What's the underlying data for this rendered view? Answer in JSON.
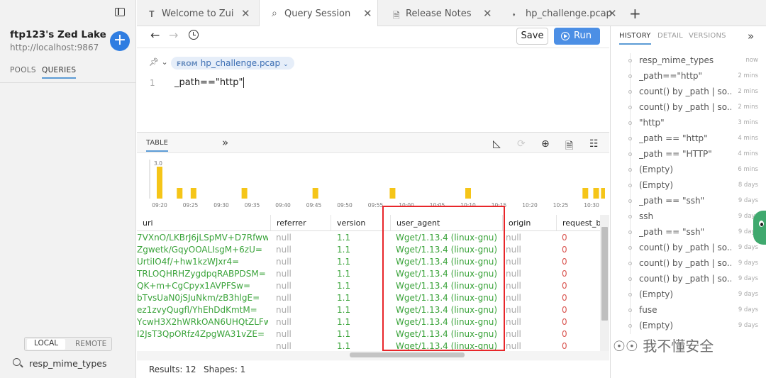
{
  "sidebar": {
    "lake_title": "ftp123's Zed Lake",
    "lake_url": "http://localhost:9867",
    "tabs": [
      "POOLS",
      "QUERIES"
    ],
    "lake_toggle": [
      "LOCAL",
      "REMOTE"
    ],
    "search_value": "resp_mime_types"
  },
  "tabs": [
    {
      "icon": "zed-icon",
      "label": "Welcome to Zui"
    },
    {
      "icon": "search-icon",
      "label": "Query Session"
    },
    {
      "icon": "document-icon",
      "label": "Release Notes"
    },
    {
      "icon": "pool-icon",
      "label": "hp_challenge.pcap"
    }
  ],
  "toolbar": {
    "save_label": "Save",
    "run_label": "Run"
  },
  "editor": {
    "from_keyword": "FROM",
    "pool": "hp_challenge.pcap",
    "line_number": "1",
    "query": "_path==\"http\""
  },
  "results": {
    "view_tab": "TABLE",
    "histogram": {
      "type": "bar",
      "y_max_label": "3.0",
      "x_tick_labels": [
        "09:20",
        "09:25",
        "09:30",
        "09:35",
        "09:40",
        "09:45",
        "09:50",
        "09:55",
        "10:00",
        "10:05",
        "10:10",
        "10:15",
        "10:20",
        "10:25",
        "10:30"
      ],
      "color": "#f5c518"
    },
    "columns": [
      "uri",
      "referrer",
      "version",
      "user_agent",
      "origin",
      "request_bo"
    ],
    "rows": [
      {
        "uri": "7VXnO/LKBrJ6jLSpMV+D7Rfww=",
        "referrer": "null",
        "version": "1.1",
        "user_agent": "Wget/1.13.4 (linux-gnu)",
        "origin": "null",
        "request_body_len": "0"
      },
      {
        "uri": "Zgwetk/GqyOOALIsgM+6zU=",
        "referrer": "null",
        "version": "1.1",
        "user_agent": "Wget/1.13.4 (linux-gnu)",
        "origin": "null",
        "request_body_len": "0"
      },
      {
        "uri": "UrtiIO4f/+hw1kzWJxr4=",
        "referrer": "null",
        "version": "1.1",
        "user_agent": "Wget/1.13.4 (linux-gnu)",
        "origin": "null",
        "request_body_len": "0"
      },
      {
        "uri": "TRLOQHRHZygdpqRABPDSM=",
        "referrer": "null",
        "version": "1.1",
        "user_agent": "Wget/1.13.4 (linux-gnu)",
        "origin": "null",
        "request_body_len": "0"
      },
      {
        "uri": "QK+m+CgCpyx1AVPFSw=",
        "referrer": "null",
        "version": "1.1",
        "user_agent": "Wget/1.13.4 (linux-gnu)",
        "origin": "null",
        "request_body_len": "0"
      },
      {
        "uri": "bTvsUaN0jSJuNkm/zB3hlgE=",
        "referrer": "null",
        "version": "1.1",
        "user_agent": "Wget/1.13.4 (linux-gnu)",
        "origin": "null",
        "request_body_len": "0"
      },
      {
        "uri": "ez1zvyQugfl/YhEhDdKmtM=",
        "referrer": "null",
        "version": "1.1",
        "user_agent": "Wget/1.13.4 (linux-gnu)",
        "origin": "null",
        "request_body_len": "0"
      },
      {
        "uri": "YcwH3X2hWRkOAN6UHQtZLFw=",
        "referrer": "null",
        "version": "1.1",
        "user_agent": "Wget/1.13.4 (linux-gnu)",
        "origin": "null",
        "request_body_len": "0"
      },
      {
        "uri": "I2JsT3QpORfz4ZpgWA31vZE=",
        "referrer": "null",
        "version": "1.1",
        "user_agent": "Wget/1.13.4 (linux-gnu)",
        "origin": "null",
        "request_body_len": "0"
      },
      {
        "uri": "",
        "referrer": "null",
        "version": "1.1",
        "user_agent": "Wget/1.13.4 (linux-gnu)",
        "origin": "null",
        "request_body_len": "0"
      }
    ],
    "status": {
      "results": "Results: 12",
      "shapes": "Shapes: 1"
    }
  },
  "right_panel": {
    "tabs": [
      "HISTORY",
      "DETAIL",
      "VERSIONS"
    ],
    "history": [
      {
        "query": "resp_mime_types",
        "time": "now"
      },
      {
        "query": "_path==\"http\"",
        "time": "2 mins"
      },
      {
        "query": "count() by _path | so...",
        "time": "2 mins"
      },
      {
        "query": "count() by _path | so...",
        "time": "2 mins"
      },
      {
        "query": "\"http\"",
        "time": "3 mins"
      },
      {
        "query": "_path == \"http\"",
        "time": "4 mins"
      },
      {
        "query": "_path == \"HTTP\"",
        "time": "4 mins"
      },
      {
        "query": "(Empty)",
        "time": "6 mins"
      },
      {
        "query": "(Empty)",
        "time": "8 days"
      },
      {
        "query": "_path == \"ssh\"",
        "time": "9 days"
      },
      {
        "query": "ssh",
        "time": "9 days"
      },
      {
        "query": "_path == \"ssh\"",
        "time": "9 days"
      },
      {
        "query": "count() by _path | so...",
        "time": "9 days"
      },
      {
        "query": "count() by _path | so...",
        "time": "9 days"
      },
      {
        "query": "count() by _path | so...",
        "time": "9 days"
      },
      {
        "query": "(Empty)",
        "time": "9 days"
      },
      {
        "query": "fuse",
        "time": "9 days"
      },
      {
        "query": "(Empty)",
        "time": "9 days"
      }
    ]
  },
  "watermark": "我不懂安全",
  "colors": {
    "accent": "#4c8fe5",
    "highlight_box": "#e8262a",
    "bar": "#f5c518",
    "value_green": "#3aa33a",
    "zero_red": "#d9544f"
  }
}
